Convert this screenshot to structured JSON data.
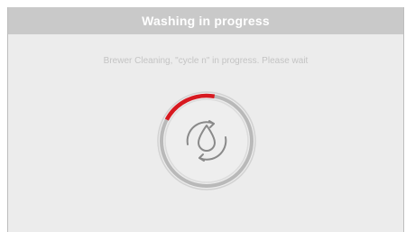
{
  "header": {
    "title": "Washing in progress"
  },
  "main": {
    "message": "Brewer Cleaning, \"cycle n\" in progress. Please wait",
    "progress": {
      "fraction": 0.2,
      "accent_color": "#d71920",
      "icon": "water-drop-cycle-icon"
    }
  }
}
